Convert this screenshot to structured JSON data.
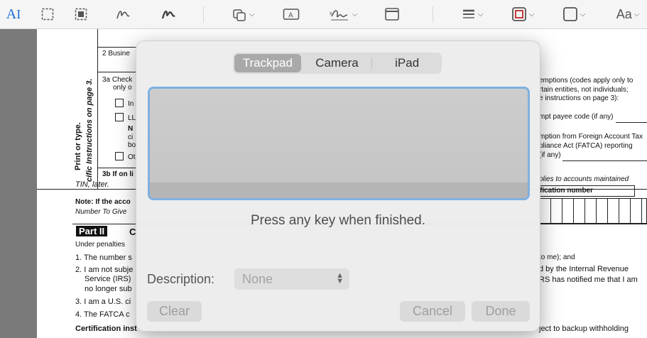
{
  "toolbar": {
    "items": [
      "text-cursor-icon",
      "select-rect-icon",
      "select-smart-icon",
      "sketch-icon",
      "draw-icon",
      "shapes-icon",
      "textbox-icon",
      "signature-icon",
      "note-icon",
      "line-style-icon",
      "border-color-icon",
      "fill-color-icon",
      "font-icon"
    ],
    "font_label": "Aa",
    "text_label": "A"
  },
  "document": {
    "line2": "2  Busine",
    "line3a": "3a  Check",
    "line3a_b": "only o",
    "cb_in": "In",
    "cb_ll": "LL",
    "cb_n": "N",
    "cb_ci": "ci",
    "cb_bo": "bo",
    "cb_ot": "Ot",
    "line3b": "3b  If on li",
    "tin_later": "TIN, later.",
    "note": "Note: If the acco",
    "note2": "Number To Give",
    "part2": "Part II",
    "part2_c": "C",
    "under": "Under penalties",
    "item1": "1. The number s",
    "item2": "2. I am not subje",
    "item2b": "Service (IRS)",
    "item2c": "no longer sub",
    "item3": "3. I am a U.S. ci",
    "item4": "4. The FATCA c",
    "cert": "Certification inst",
    "cert_tail": "ject to backup withholding",
    "side_print": "Print or type.",
    "side_specific": "cific Instructions on page 3.",
    "r_exempt": "emptions (codes apply only to",
    "r_certain": "rtain entities, not individuals;",
    "r_instr": "e instructions on page 3):",
    "r_payee": "mpt payee code (if any)",
    "r_exemption": "mption from Foreign Account Tax",
    "r_compliance": "pliance Act (FATCA) reporting",
    "r_ifany": "(if any)",
    "r_accounts": "olies to accounts maintained",
    "r_ident": "fication number",
    "r_tome": "to me); and",
    "r_irs": "d by the Internal Revenue",
    "r_rs": "RS has notified me that I am"
  },
  "dialog": {
    "tabs": [
      "Trackpad",
      "Camera",
      "iPad"
    ],
    "active_tab": "Trackpad",
    "hint": "Press any key when finished.",
    "description_label": "Description:",
    "description_value": "None",
    "clear_label": "Clear",
    "cancel_label": "Cancel",
    "done_label": "Done"
  },
  "colors": {
    "accent": "#1a6ed8",
    "pad_focus": "#7fb0e0",
    "segment_active": "#a9a9a9"
  }
}
